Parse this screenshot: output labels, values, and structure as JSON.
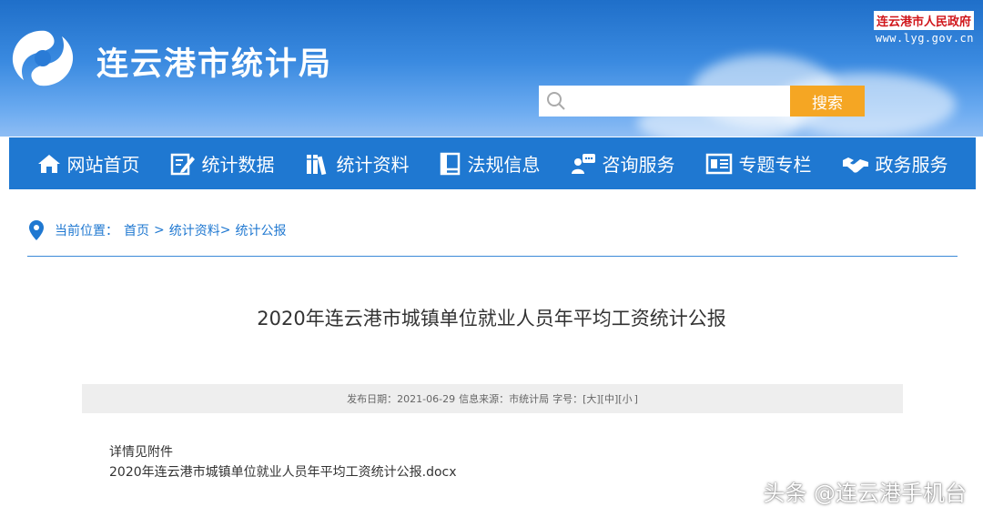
{
  "header": {
    "site_title": "连云港市统计局",
    "gov_name": "连云港市人民政府",
    "gov_url": "www.lyg.gov.cn",
    "search": {
      "placeholder": "",
      "button_label": "搜索"
    }
  },
  "nav": {
    "items": [
      {
        "label": "网站首页",
        "icon": "home-icon"
      },
      {
        "label": "统计数据",
        "icon": "edit-data-icon"
      },
      {
        "label": "统计资料",
        "icon": "books-icon"
      },
      {
        "label": "法规信息",
        "icon": "law-book-icon"
      },
      {
        "label": "咨询服务",
        "icon": "consult-icon"
      },
      {
        "label": "专题专栏",
        "icon": "topic-icon"
      },
      {
        "label": "政务服务",
        "icon": "handshake-icon"
      }
    ]
  },
  "breadcrumb": {
    "prefix": "当前位置：",
    "items": [
      "首页",
      "统计资料",
      "统计公报"
    ],
    "sep": ">"
  },
  "article": {
    "title": "2020年连云港市城镇单位就业人员年平均工资统计公报",
    "meta": {
      "date_label": "发布日期：2021-06-29",
      "source_label": "信息来源：市统计局",
      "font_label": "字号：[",
      "large": "大",
      "medium": "中",
      "small": "小",
      "close": "]"
    },
    "intro": "详情见附件",
    "attachment": "2020年连云港市城镇单位就业人员年平均工资统计公报.docx"
  },
  "watermark": "头条 @连云港手机台",
  "colors": {
    "nav_bg": "#1f78d1",
    "search_btn": "#f5a623",
    "gov_red": "#d0161b"
  }
}
